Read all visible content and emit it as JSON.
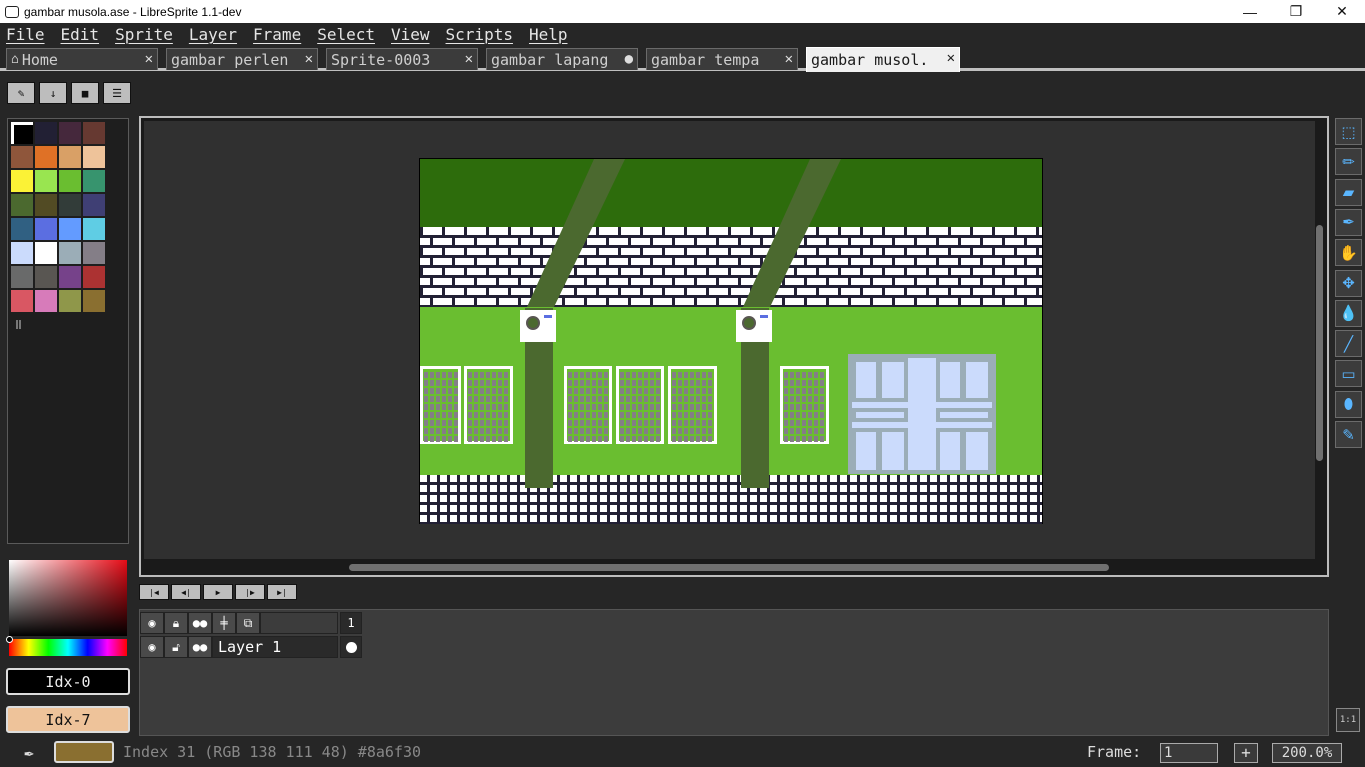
{
  "window": {
    "title": "gambar musola.ase - LibreSprite 1.1-dev",
    "minimize": "—",
    "maximize": "❐",
    "close": "✕"
  },
  "menu": [
    "File",
    "Edit",
    "Sprite",
    "Layer",
    "Frame",
    "Select",
    "View",
    "Scripts",
    "Help"
  ],
  "tabs": [
    {
      "label": "Home",
      "close": "✕"
    },
    {
      "label": "gambar perlen",
      "close": "✕"
    },
    {
      "label": "Sprite-0003",
      "close": "✕"
    },
    {
      "label": "gambar lapang",
      "close": "●"
    },
    {
      "label": "gambar tempa",
      "close": "✕"
    },
    {
      "label": "gambar musol.",
      "close": "✕"
    }
  ],
  "palette_colors": [
    "#000000",
    "#222034",
    "#45283c",
    "#663931",
    "#8f563b",
    "#df7126",
    "#d9a066",
    "#eec39a",
    "#fbf236",
    "#99e550",
    "#6abe30",
    "#37946e",
    "#4b692f",
    "#524b24",
    "#323c39",
    "#3f3f74",
    "#306082",
    "#5b6ee1",
    "#639bff",
    "#5fcde4",
    "#cbdbfc",
    "#ffffff",
    "#9badb7",
    "#847e87",
    "#696a6a",
    "#595652",
    "#76428a",
    "#ac3232",
    "#d95763",
    "#d77bba",
    "#8f974a",
    "#8a6f30"
  ],
  "colors": {
    "foreground_label": "Idx-0",
    "background_label": "Idx-7",
    "background_color": "#eec39a"
  },
  "timeline": {
    "frame_header": "1",
    "layer_name": "Layer 1"
  },
  "status": {
    "color_info": "Index 31 (RGB 138 111 48) #8a6f30",
    "current_color": "#8a6f30",
    "frame_label": "Frame:",
    "frame_value": "1",
    "add_frame": "+",
    "zoom": "200.0%",
    "zoom_one": "1:1"
  },
  "tools": [
    "rectangular-marquee",
    "pencil",
    "eraser",
    "eyedropper",
    "hand",
    "move",
    "paint-bucket",
    "line",
    "rectangle",
    "ellipse",
    "spray"
  ]
}
